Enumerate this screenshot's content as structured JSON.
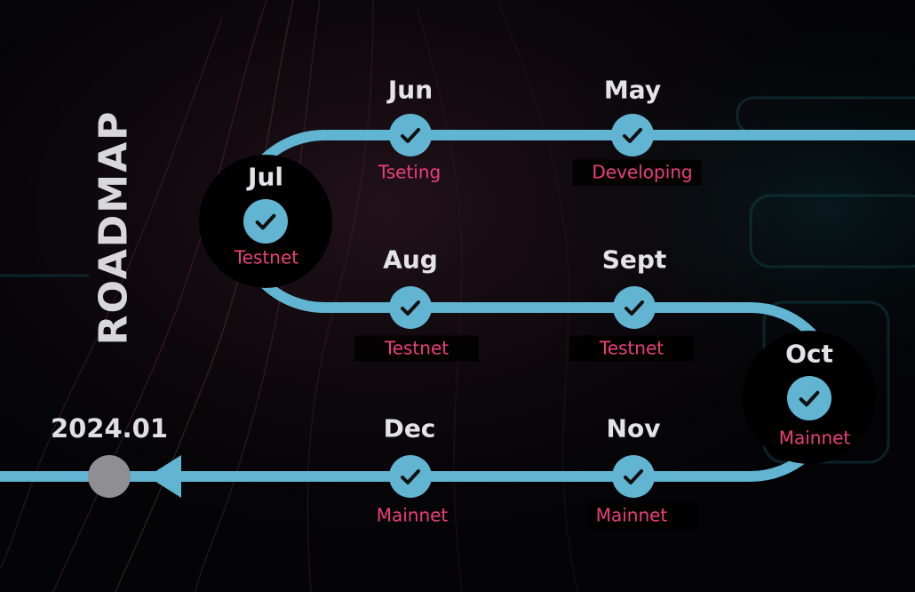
{
  "title": "ROADMAP",
  "start_label": "2024.01",
  "colors": {
    "track": "#62b5d2",
    "accent_text": "#ec3f7c",
    "month_text": "#e4e4e8",
    "hub_bg": "#000000",
    "start_dot": "#8f8f93"
  },
  "milestones": {
    "may": {
      "month": "May",
      "status": "Developing",
      "icon": "check-icon"
    },
    "jun": {
      "month": "Jun",
      "status": "Tseting",
      "icon": "check-icon"
    },
    "jul": {
      "month": "Jul",
      "status": "Testnet",
      "icon": "check-icon"
    },
    "aug": {
      "month": "Aug",
      "status": "Testnet",
      "icon": "check-icon"
    },
    "sept": {
      "month": "Sept",
      "status": "Testnet",
      "icon": "check-icon"
    },
    "oct": {
      "month": "Oct",
      "status": "Mainnet",
      "icon": "check-icon"
    },
    "nov": {
      "month": "Nov",
      "status": "Mainnet",
      "icon": "check-icon"
    },
    "dec": {
      "month": "Dec",
      "status": "Mainnet",
      "icon": "check-icon"
    }
  }
}
